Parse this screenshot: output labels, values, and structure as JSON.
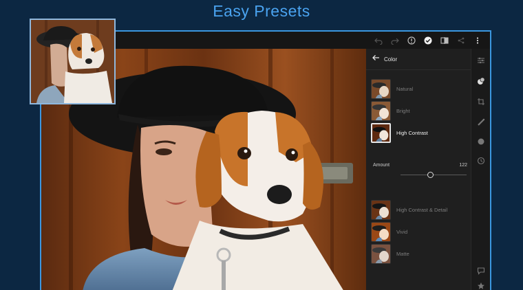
{
  "headline": "Easy Presets",
  "panel": {
    "title": "Color",
    "presets": [
      {
        "label": "Natural",
        "active": false
      },
      {
        "label": "Bright",
        "active": false
      },
      {
        "label": "High Contrast",
        "active": true
      },
      {
        "label": "High Contrast & Detail",
        "active": false
      },
      {
        "label": "Vivid",
        "active": false
      },
      {
        "label": "Matte",
        "active": false
      }
    ],
    "amount": {
      "label": "Amount",
      "value": "122"
    }
  },
  "toolbar_icons": [
    "undo-icon",
    "redo-icon",
    "help-icon",
    "check-icon",
    "compare-icon",
    "share-icon",
    "more-icon"
  ],
  "tool_icons": [
    "sliders-icon",
    "presets-icon",
    "crop-icon",
    "healing-icon",
    "selective-icon",
    "history-icon",
    "comment-icon",
    "star-icon"
  ],
  "colors": {
    "accent": "#3b97e0",
    "headline": "#4aa3f0",
    "background": "#0c2742"
  }
}
